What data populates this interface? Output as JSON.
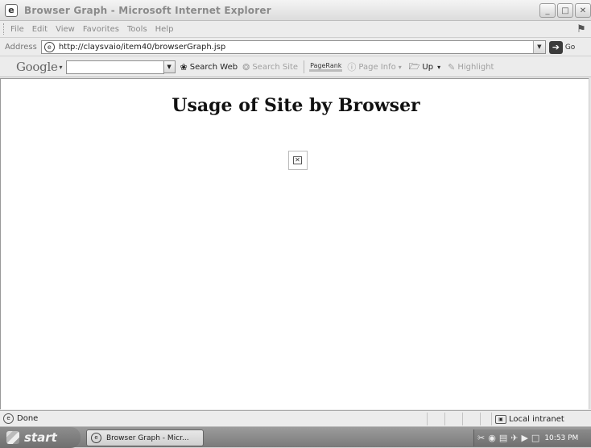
{
  "window": {
    "title": "Browser Graph - Microsoft Internet Explorer"
  },
  "menubar": {
    "items": [
      "File",
      "Edit",
      "View",
      "Favorites",
      "Tools",
      "Help"
    ]
  },
  "addressbar": {
    "label": "Address",
    "url": "http://claysvaio/item40/browserGraph.jsp",
    "go_label": "Go"
  },
  "google_toolbar": {
    "logo": "Google",
    "search_value": "",
    "search_web": "Search Web",
    "search_site": "Search Site",
    "pagerank": "PageRank",
    "page_info": "Page Info",
    "up": "Up",
    "highlight": "Highlight"
  },
  "page": {
    "heading": "Usage of Site by Browser"
  },
  "statusbar": {
    "status": "Done",
    "zone": "Local intranet"
  },
  "taskbar": {
    "start": "start",
    "task_label": "Browser Graph - Micr...",
    "clock": "10:53 PM"
  }
}
